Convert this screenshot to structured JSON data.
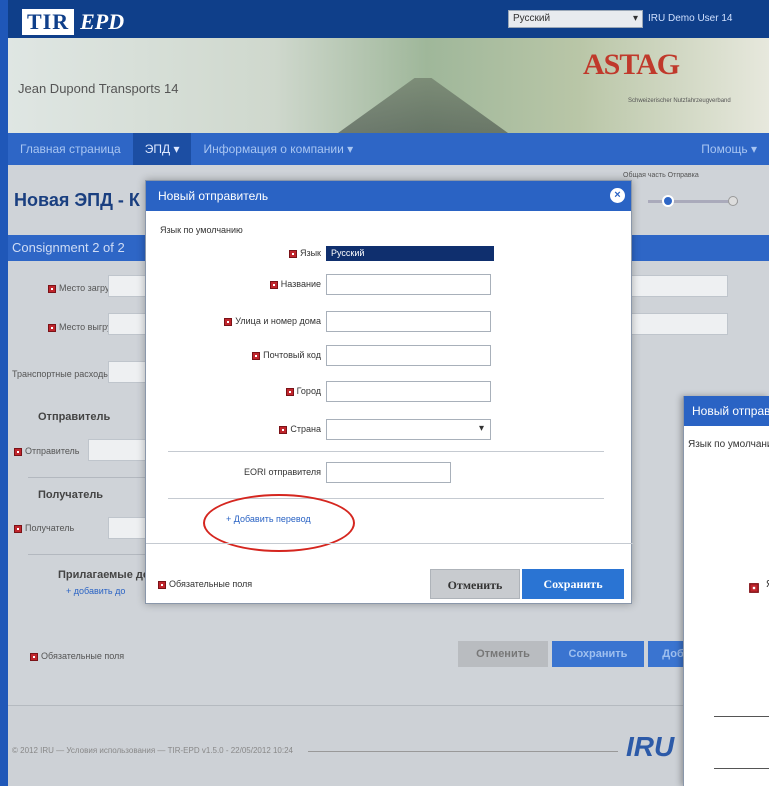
{
  "app": {
    "logo_tir": "TIR",
    "logo_epd": "EPD",
    "language_select": "Русский",
    "user": "IRU Demo User 14",
    "company": "Jean Dupond Transports 14",
    "partner_logo": "ASTAG",
    "partner_sub": "Schweizerischer Nutzfahrzeugverband"
  },
  "navbar": {
    "items": [
      "Главная страница",
      "ЭПД ▾",
      "Информация о компании ▾"
    ],
    "help": "Помощь ▾"
  },
  "page": {
    "title": "Новая ЭПД - К",
    "progress_labels": "Общая часть     Отправка",
    "section": "Consignment 2 of 2"
  },
  "background_form": {
    "labels": [
      "Место загрузки",
      "Место выгрузки",
      "Транспортные расходы",
      "Отправитель",
      "Отправитель",
      "Получатель",
      "Получатель",
      "Прилагаемые до",
      "+ добавить до"
    ],
    "required_note": "Обязательные поля",
    "cancel": "Отменить",
    "save": "Сохранить",
    "add": "Доб"
  },
  "footer": {
    "text": "© 2012 IRU — Условия использования — TIR-EPD v1.5.0 - 22/05/2012 10:24",
    "logo": "IRU"
  },
  "dialog": {
    "title": "Новый отправитель",
    "default_language_label": "Язык по умолчанию",
    "fields": [
      {
        "label": "Язык",
        "value": "Русский",
        "required": true
      },
      {
        "label": "Название",
        "value": "",
        "required": true
      },
      {
        "label": "Улица и номер дома",
        "value": "",
        "required": true
      },
      {
        "label": "Почтовый код",
        "value": "",
        "required": true
      },
      {
        "label": "Город",
        "value": "",
        "required": true
      },
      {
        "label": "Страна",
        "value": "",
        "required": true
      }
    ],
    "eori_label": "EORI отправителя",
    "add_translation": "+ Добавить перевод",
    "required_note": "Обязательные поля",
    "cancel": "Отменить",
    "save": "Сохранить"
  },
  "dialog2": {
    "title": "Новый отправитель",
    "default_language_label": "Язык по умолчанию",
    "tail_char": "Я"
  }
}
